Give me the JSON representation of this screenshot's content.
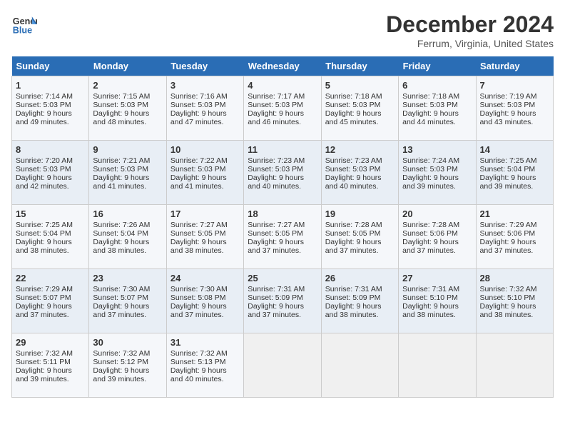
{
  "header": {
    "logo_general": "General",
    "logo_blue": "Blue",
    "title": "December 2024",
    "location": "Ferrum, Virginia, United States"
  },
  "days_of_week": [
    "Sunday",
    "Monday",
    "Tuesday",
    "Wednesday",
    "Thursday",
    "Friday",
    "Saturday"
  ],
  "weeks": [
    [
      {
        "day": "1",
        "sunrise": "Sunrise: 7:14 AM",
        "sunset": "Sunset: 5:03 PM",
        "daylight": "Daylight: 9 hours and 49 minutes."
      },
      {
        "day": "2",
        "sunrise": "Sunrise: 7:15 AM",
        "sunset": "Sunset: 5:03 PM",
        "daylight": "Daylight: 9 hours and 48 minutes."
      },
      {
        "day": "3",
        "sunrise": "Sunrise: 7:16 AM",
        "sunset": "Sunset: 5:03 PM",
        "daylight": "Daylight: 9 hours and 47 minutes."
      },
      {
        "day": "4",
        "sunrise": "Sunrise: 7:17 AM",
        "sunset": "Sunset: 5:03 PM",
        "daylight": "Daylight: 9 hours and 46 minutes."
      },
      {
        "day": "5",
        "sunrise": "Sunrise: 7:18 AM",
        "sunset": "Sunset: 5:03 PM",
        "daylight": "Daylight: 9 hours and 45 minutes."
      },
      {
        "day": "6",
        "sunrise": "Sunrise: 7:18 AM",
        "sunset": "Sunset: 5:03 PM",
        "daylight": "Daylight: 9 hours and 44 minutes."
      },
      {
        "day": "7",
        "sunrise": "Sunrise: 7:19 AM",
        "sunset": "Sunset: 5:03 PM",
        "daylight": "Daylight: 9 hours and 43 minutes."
      }
    ],
    [
      {
        "day": "8",
        "sunrise": "Sunrise: 7:20 AM",
        "sunset": "Sunset: 5:03 PM",
        "daylight": "Daylight: 9 hours and 42 minutes."
      },
      {
        "day": "9",
        "sunrise": "Sunrise: 7:21 AM",
        "sunset": "Sunset: 5:03 PM",
        "daylight": "Daylight: 9 hours and 41 minutes."
      },
      {
        "day": "10",
        "sunrise": "Sunrise: 7:22 AM",
        "sunset": "Sunset: 5:03 PM",
        "daylight": "Daylight: 9 hours and 41 minutes."
      },
      {
        "day": "11",
        "sunrise": "Sunrise: 7:23 AM",
        "sunset": "Sunset: 5:03 PM",
        "daylight": "Daylight: 9 hours and 40 minutes."
      },
      {
        "day": "12",
        "sunrise": "Sunrise: 7:23 AM",
        "sunset": "Sunset: 5:03 PM",
        "daylight": "Daylight: 9 hours and 40 minutes."
      },
      {
        "day": "13",
        "sunrise": "Sunrise: 7:24 AM",
        "sunset": "Sunset: 5:03 PM",
        "daylight": "Daylight: 9 hours and 39 minutes."
      },
      {
        "day": "14",
        "sunrise": "Sunrise: 7:25 AM",
        "sunset": "Sunset: 5:04 PM",
        "daylight": "Daylight: 9 hours and 39 minutes."
      }
    ],
    [
      {
        "day": "15",
        "sunrise": "Sunrise: 7:25 AM",
        "sunset": "Sunset: 5:04 PM",
        "daylight": "Daylight: 9 hours and 38 minutes."
      },
      {
        "day": "16",
        "sunrise": "Sunrise: 7:26 AM",
        "sunset": "Sunset: 5:04 PM",
        "daylight": "Daylight: 9 hours and 38 minutes."
      },
      {
        "day": "17",
        "sunrise": "Sunrise: 7:27 AM",
        "sunset": "Sunset: 5:05 PM",
        "daylight": "Daylight: 9 hours and 38 minutes."
      },
      {
        "day": "18",
        "sunrise": "Sunrise: 7:27 AM",
        "sunset": "Sunset: 5:05 PM",
        "daylight": "Daylight: 9 hours and 37 minutes."
      },
      {
        "day": "19",
        "sunrise": "Sunrise: 7:28 AM",
        "sunset": "Sunset: 5:05 PM",
        "daylight": "Daylight: 9 hours and 37 minutes."
      },
      {
        "day": "20",
        "sunrise": "Sunrise: 7:28 AM",
        "sunset": "Sunset: 5:06 PM",
        "daylight": "Daylight: 9 hours and 37 minutes."
      },
      {
        "day": "21",
        "sunrise": "Sunrise: 7:29 AM",
        "sunset": "Sunset: 5:06 PM",
        "daylight": "Daylight: 9 hours and 37 minutes."
      }
    ],
    [
      {
        "day": "22",
        "sunrise": "Sunrise: 7:29 AM",
        "sunset": "Sunset: 5:07 PM",
        "daylight": "Daylight: 9 hours and 37 minutes."
      },
      {
        "day": "23",
        "sunrise": "Sunrise: 7:30 AM",
        "sunset": "Sunset: 5:07 PM",
        "daylight": "Daylight: 9 hours and 37 minutes."
      },
      {
        "day": "24",
        "sunrise": "Sunrise: 7:30 AM",
        "sunset": "Sunset: 5:08 PM",
        "daylight": "Daylight: 9 hours and 37 minutes."
      },
      {
        "day": "25",
        "sunrise": "Sunrise: 7:31 AM",
        "sunset": "Sunset: 5:09 PM",
        "daylight": "Daylight: 9 hours and 37 minutes."
      },
      {
        "day": "26",
        "sunrise": "Sunrise: 7:31 AM",
        "sunset": "Sunset: 5:09 PM",
        "daylight": "Daylight: 9 hours and 38 minutes."
      },
      {
        "day": "27",
        "sunrise": "Sunrise: 7:31 AM",
        "sunset": "Sunset: 5:10 PM",
        "daylight": "Daylight: 9 hours and 38 minutes."
      },
      {
        "day": "28",
        "sunrise": "Sunrise: 7:32 AM",
        "sunset": "Sunset: 5:10 PM",
        "daylight": "Daylight: 9 hours and 38 minutes."
      }
    ],
    [
      {
        "day": "29",
        "sunrise": "Sunrise: 7:32 AM",
        "sunset": "Sunset: 5:11 PM",
        "daylight": "Daylight: 9 hours and 39 minutes."
      },
      {
        "day": "30",
        "sunrise": "Sunrise: 7:32 AM",
        "sunset": "Sunset: 5:12 PM",
        "daylight": "Daylight: 9 hours and 39 minutes."
      },
      {
        "day": "31",
        "sunrise": "Sunrise: 7:32 AM",
        "sunset": "Sunset: 5:13 PM",
        "daylight": "Daylight: 9 hours and 40 minutes."
      },
      null,
      null,
      null,
      null
    ]
  ]
}
